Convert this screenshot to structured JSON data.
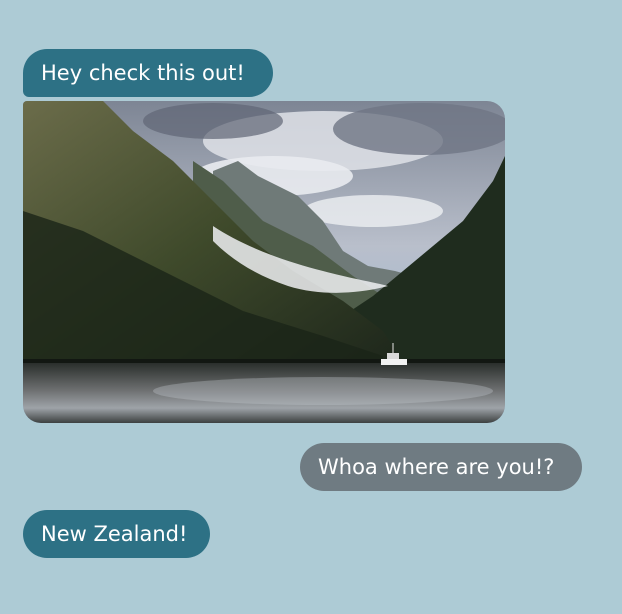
{
  "chat": {
    "messages": [
      {
        "sender": "them",
        "text": "Hey check this out!"
      },
      {
        "sender": "them",
        "type": "image",
        "icon": "landscape-photo"
      },
      {
        "sender": "me",
        "text": "Whoa where are you!?"
      },
      {
        "sender": "them",
        "text": "New Zealand!"
      }
    ]
  },
  "colors": {
    "background": "#adcbd5",
    "incoming_bubble": "#2d7185",
    "outgoing_bubble": "#6f7b82",
    "bubble_text": "#ffffff"
  }
}
